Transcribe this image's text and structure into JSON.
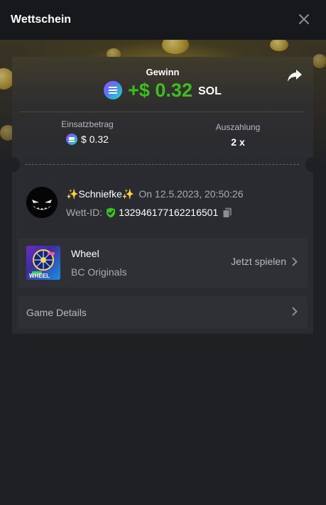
{
  "header": {
    "title": "Wettschein",
    "close_icon": "close-icon"
  },
  "result": {
    "label": "Gewinn",
    "amount": "+$ 0.32",
    "currency": "SOL",
    "amount_color": "#3bc117",
    "currency_icon": "solana-icon",
    "share_icon": "share-icon"
  },
  "stats": {
    "bet_label": "Einsatzbetrag",
    "bet_value": "$ 0.32",
    "payout_label": "Auszahlung",
    "payout_value": "2 x"
  },
  "user": {
    "sparkle_left": "✨",
    "name": "Schniefke",
    "sparkle_right": "✨",
    "time": "On 12.5.2023, 20:50:26",
    "bet_id_label": "Wett-ID:",
    "bet_id": "132946177162216501",
    "verified_icon": "shield-check-icon",
    "copy_icon": "copy-icon"
  },
  "game": {
    "name": "Wheel",
    "provider": "BC Originals",
    "play_label": "Jetzt spielen",
    "thumb_text": "WHEEL"
  },
  "details": {
    "label": "Game Details"
  },
  "colors": {
    "background": "#1f2024",
    "header": "#17181b",
    "card": "#2a2b30",
    "row": "#2f3035",
    "accent_green": "#3bc117"
  }
}
